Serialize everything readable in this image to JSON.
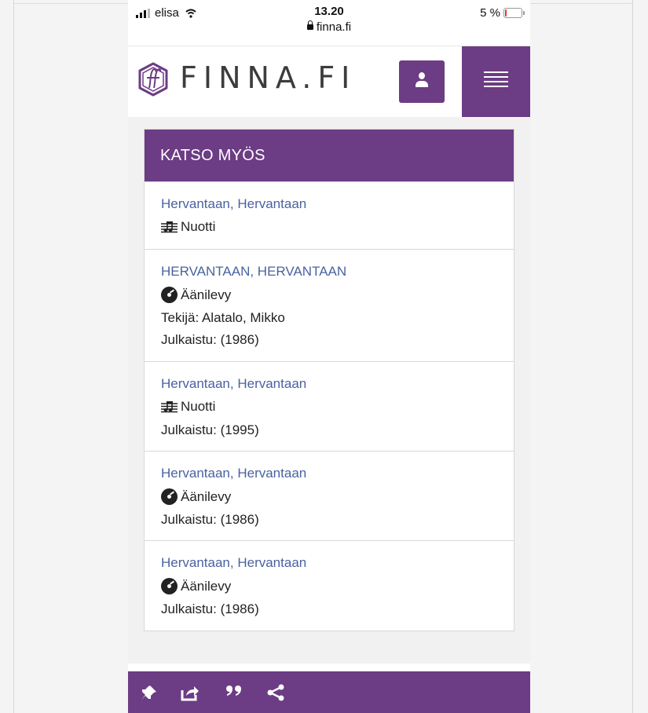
{
  "status_bar": {
    "carrier": "elisa",
    "time": "13.20",
    "url": "finna.fi",
    "battery_text": "5 %"
  },
  "header": {
    "logo_text": "FINNA.FI"
  },
  "panel": {
    "title": "KATSO MYÖS",
    "items": [
      {
        "title": "Hervantaan, Hervantaan",
        "format": "Nuotti",
        "format_icon": "sheet-music-icon"
      },
      {
        "title": "HERVANTAAN, HERVANTAAN",
        "format": "Äänilevy",
        "format_icon": "disc-icon",
        "author": "Tekijä: Alatalo, Mikko",
        "published": "Julkaistu: (1986)"
      },
      {
        "title": "Hervantaan, Hervantaan",
        "format": "Nuotti",
        "format_icon": "sheet-music-icon",
        "published": "Julkaistu: (1995)"
      },
      {
        "title": "Hervantaan, Hervantaan",
        "format": "Äänilevy",
        "format_icon": "disc-icon",
        "published": "Julkaistu: (1986)"
      },
      {
        "title": "Hervantaan, Hervantaan",
        "format": "Äänilevy",
        "format_icon": "disc-icon",
        "published": "Julkaistu: (1986)"
      }
    ]
  },
  "toolbar": {
    "icons": [
      "pin-icon",
      "export-icon",
      "cite-icon",
      "share-icon"
    ]
  },
  "colors": {
    "brand": "#6c3c84",
    "link": "#4a62a0"
  }
}
